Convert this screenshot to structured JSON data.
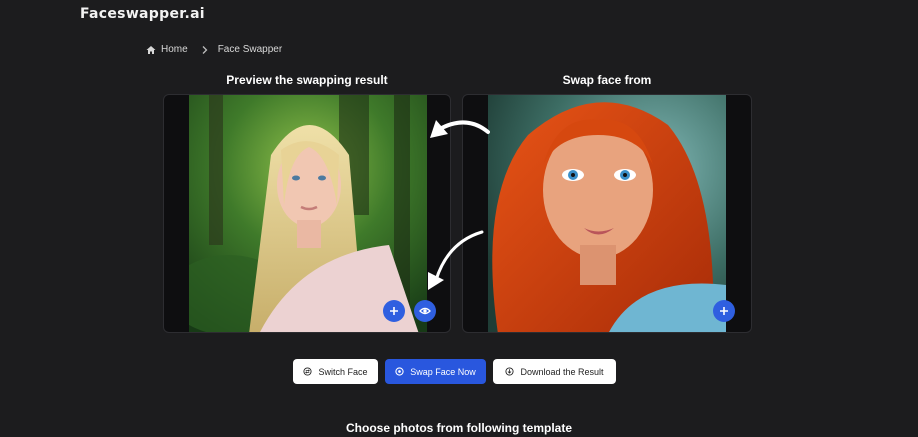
{
  "brand": {
    "name": "Faceswapper.ai"
  },
  "breadcrumb": {
    "home": "Home",
    "current": "Face Swapper"
  },
  "preview": {
    "title": "Preview the swapping result"
  },
  "source": {
    "title": "Swap face from"
  },
  "actions": {
    "switch_label": "Switch Face",
    "swap_label": "Swap Face Now",
    "download_label": "Download the Result"
  },
  "templates": {
    "title": "Choose photos from following template"
  },
  "colors": {
    "accent": "#2957de",
    "background": "#1c1c1e",
    "panel": "#0e0e10"
  },
  "icons": [
    "home-icon",
    "chevron-right-icon",
    "plus-icon",
    "eye-icon",
    "switch-icon",
    "swap-icon",
    "download-icon",
    "curved-arrow-icon"
  ]
}
